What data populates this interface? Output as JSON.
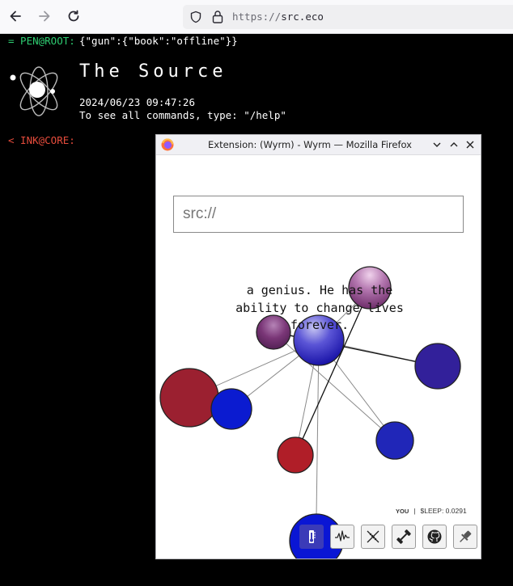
{
  "browser": {
    "url_scheme": "https://",
    "url_host": "src.eco"
  },
  "terminal": {
    "root_prompt": "= PEN@ROOT:",
    "root_json": "{\"gun\":{\"book\":\"offline\"}}",
    "title": "The Source",
    "datetime": "2024/06/23 09:47:26",
    "help_text": "To see all commands, type: \"/help\"",
    "core_prompt": "< INK@CORE:"
  },
  "popup": {
    "window_title": "Extension: (Wyrm) - Wyrm — Mozilla Firefox",
    "search_placeholder": "src://",
    "quote": "a genius. He has the ability to change lives forever.",
    "status_you": "YOU",
    "status_sep": "|",
    "status_sleep": "$LEEP: 0.0291",
    "tools": [
      {
        "name": "thermometer-icon",
        "active": true
      },
      {
        "name": "waveform-icon",
        "active": false
      },
      {
        "name": "dna-icon",
        "active": false
      },
      {
        "name": "dumbbell-icon",
        "active": false
      },
      {
        "name": "github-icon",
        "active": false
      },
      {
        "name": "pin-icon",
        "active": false
      }
    ]
  },
  "colors": {
    "root_green": "#2ecc71",
    "core_red": "#e74c3c",
    "node_blue": "#0b1bd0",
    "node_crimson": "#9b2030",
    "node_purple": "#8b3a7a",
    "node_indigo": "#32209a"
  }
}
